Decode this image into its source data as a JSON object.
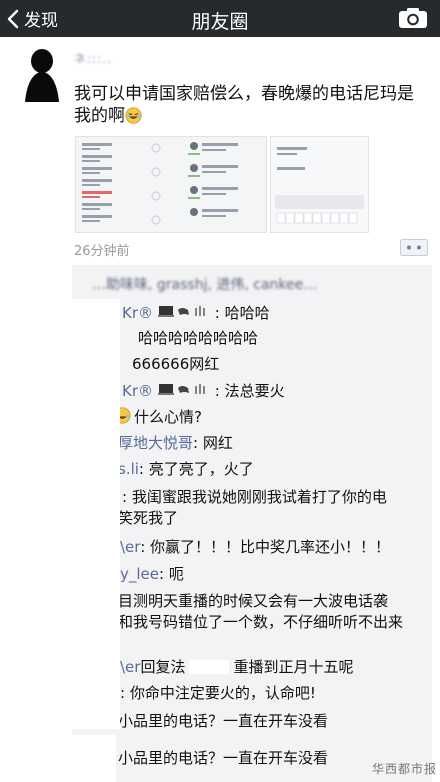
{
  "navbar": {
    "back_label": "发现",
    "title": "朋友圈"
  },
  "post": {
    "username": "ネ:::..",
    "text": "我可以申请国家赔偿么，春晚爆的电话尼玛是我的啊",
    "time": "26分钟前"
  },
  "comments": {
    "header_blurred": "…助味味, grasshj, 进伟, cankee…",
    "lines": [
      {
        "name": "Kr®",
        "text": ": 哈哈哈"
      },
      {
        "name": "",
        "text": "哈哈哈哈哈哈哈哈"
      },
      {
        "name": "",
        "text": "666666网红"
      },
      {
        "name": "Kr®",
        "text": ": 法总要火"
      },
      {
        "name": "",
        "text": "什么心情?"
      },
      {
        "name": "厚地大悦哥",
        "text": ": 网红"
      },
      {
        "name": "s.li",
        "text": ": 亮了亮了，火了"
      },
      {
        "name": "",
        "text": ": 我闺蜜跟我说她刚刚我试着打了你的电"
      },
      {
        "name": "",
        "text": "笑死我了"
      },
      {
        "name": "\\er",
        "text": ": 你赢了！！！比中奖几率还小！！！"
      },
      {
        "name": "y_lee",
        "text": ": 呃"
      },
      {
        "name": "",
        "text": "目测明天重播的时候又会有一大波电话袭"
      },
      {
        "name": "",
        "text": "和我号码错位了一个数，不仔细听听不出来"
      },
      {
        "name": "\\er",
        "text": "回复法",
        "tail": "重播到正月十五呢"
      },
      {
        "name": "",
        "text": ": 你命中注定要火的，认命吧!"
      },
      {
        "name": "",
        "text": "小品里的电话？一直在开车没看"
      },
      {
        "name": "",
        "text": "小品里的电话？一直在开车没看"
      }
    ]
  },
  "watermark": "华西都市报",
  "colors": {
    "navbar": "#262a2d",
    "name_blue": "#576b95",
    "comment_bg": "#f3f3f5"
  }
}
